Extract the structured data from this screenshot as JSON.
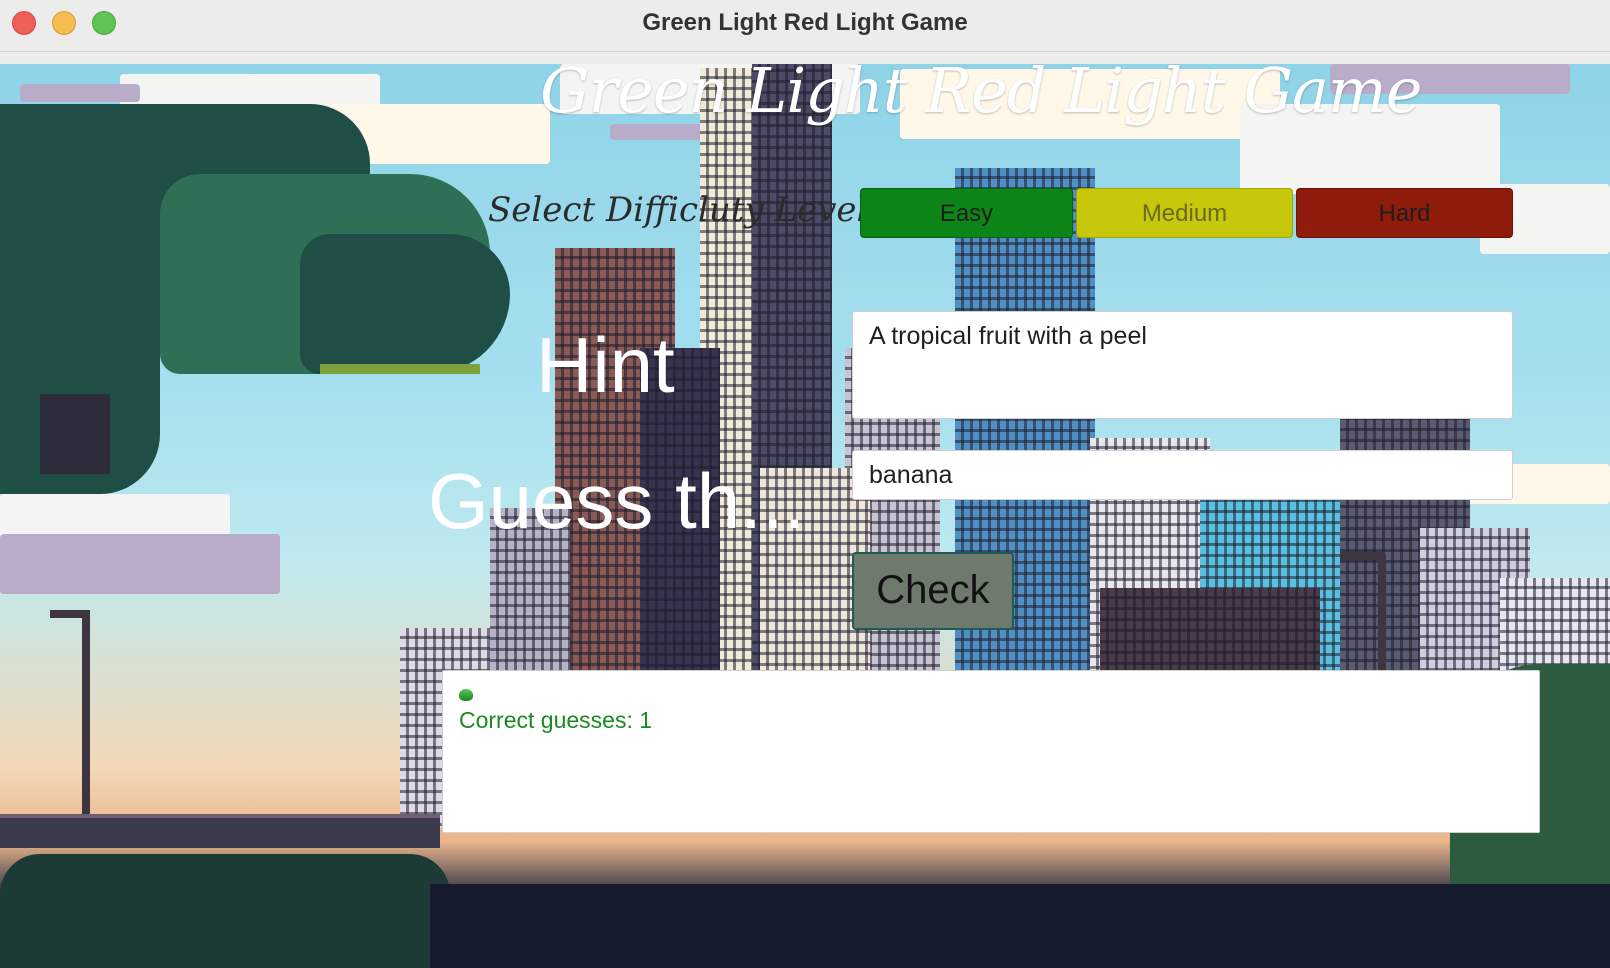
{
  "window": {
    "title": "Green Light Red Light Game"
  },
  "app": {
    "heading": "Green Light Red Light Game",
    "difficulty_label": "Select Difficluty Level",
    "difficulty_buttons": [
      {
        "label": "Easy",
        "color": "#0d8418"
      },
      {
        "label": "Medium",
        "color": "#c7c70b"
      },
      {
        "label": "Hard",
        "color": "#8f1c0a"
      }
    ],
    "hint_label": "Hint",
    "hint_text": "A tropical fruit with a peel",
    "guess_label": "Guess th...",
    "guess_value": "banana",
    "check_label": "Check",
    "result": {
      "status_light": "green-light-icon",
      "status_color": "#1c8a1e",
      "message": "Correct guesses: 1"
    }
  }
}
